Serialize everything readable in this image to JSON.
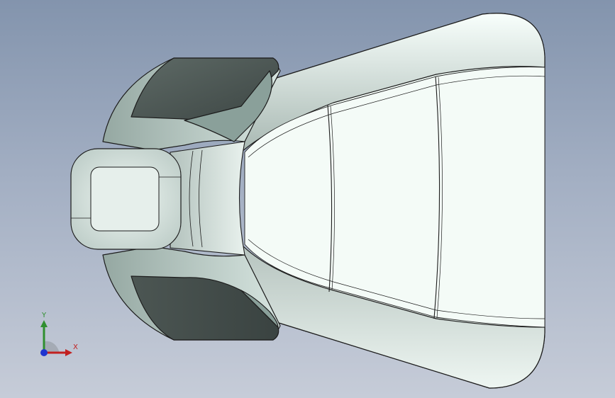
{
  "view": {
    "background_top": "#8394ad",
    "background_bottom": "#c6ccd8",
    "part_light": "#eef6f1",
    "part_shadow": "#4f5a57",
    "edge": "#1c1c1c"
  },
  "triad": {
    "y_label": "Y",
    "x_label": "X",
    "y_color": "#2f8f2f",
    "x_color": "#c22020",
    "z_color": "#1f35d0"
  }
}
